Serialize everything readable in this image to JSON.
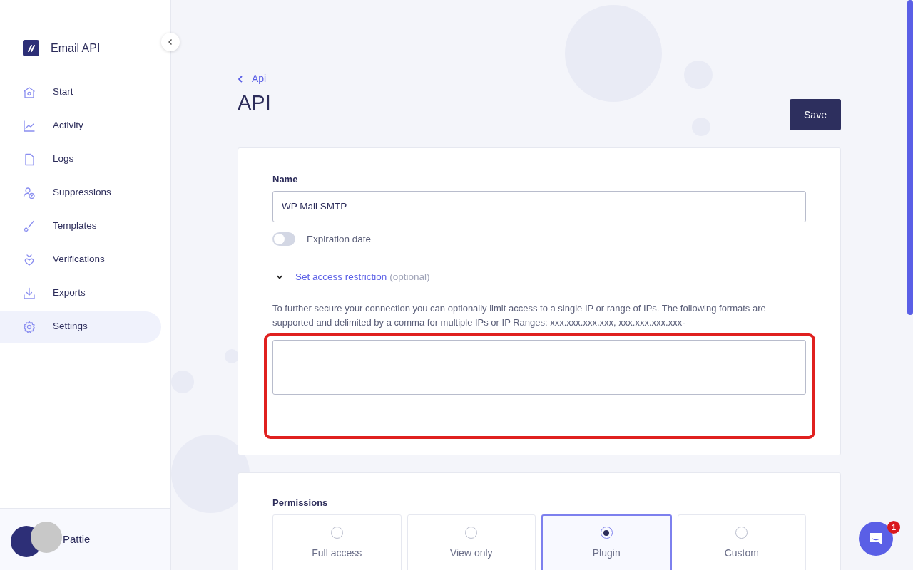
{
  "brand": {
    "name": "Email API"
  },
  "sidebar": {
    "items": [
      {
        "label": "Start",
        "selected": false
      },
      {
        "label": "Activity",
        "selected": false
      },
      {
        "label": "Logs",
        "selected": false
      },
      {
        "label": "Suppressions",
        "selected": false
      },
      {
        "label": "Templates",
        "selected": false
      },
      {
        "label": "Verifications",
        "selected": false
      },
      {
        "label": "Exports",
        "selected": false
      },
      {
        "label": "Settings",
        "selected": true
      }
    ]
  },
  "user": {
    "name": "Pattie"
  },
  "breadcrumb": "Api",
  "page_title": "API",
  "save_button": "Save",
  "form": {
    "name_label": "Name",
    "name_value": "WP Mail SMTP",
    "expiration": {
      "label": "Expiration date",
      "on": false
    },
    "restriction": {
      "label": "Set access restriction",
      "hint": "(optional)",
      "expanded": true,
      "help": "To further secure your connection you can optionally limit access to a single IP or range of IPs. The following formats are supported and delimited by a comma for multiple IPs or IP Ranges: xxx.xxx.xxx.xxx, xxx.xxx.xxx.xxx-"
    }
  },
  "permissions": {
    "label": "Permissions",
    "options": [
      {
        "label": "Full access",
        "selected": false
      },
      {
        "label": "View only",
        "selected": false
      },
      {
        "label": "Plugin",
        "selected": true
      },
      {
        "label": "Custom",
        "selected": false
      }
    ]
  },
  "chat": {
    "badge": "1"
  }
}
